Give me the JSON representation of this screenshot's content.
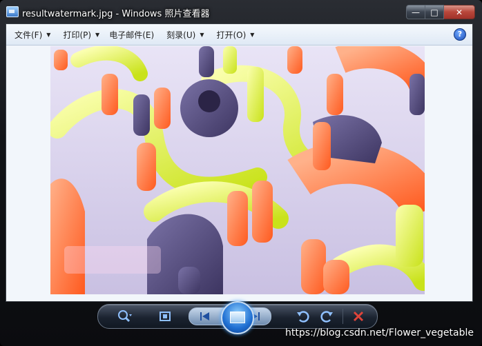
{
  "window": {
    "title": "resultwatermark.jpg - Windows 照片查看器",
    "minimize_glyph": "—",
    "maximize_glyph": "□",
    "close_glyph": "✕"
  },
  "menu": {
    "items": [
      {
        "label": "文件(F)",
        "has_arrow": true
      },
      {
        "label": "打印(P)",
        "has_arrow": true
      },
      {
        "label": "电子邮件(E)",
        "has_arrow": false
      },
      {
        "label": "刻录(U)",
        "has_arrow": true
      },
      {
        "label": "打开(O)",
        "has_arrow": true
      }
    ],
    "arrow_glyph": "▼",
    "help_glyph": "?"
  },
  "photo": {
    "description_icon": "image-abstract-3d-shapes",
    "accent_colors": [
      "#ff7a3d",
      "#e2f03a",
      "#4d4373",
      "#f7f29a"
    ]
  },
  "toolbar": {
    "icons": [
      "zoom-icon",
      "actual-size-icon",
      "previous-icon",
      "slideshow-icon",
      "next-icon",
      "rotate-ccw-icon",
      "rotate-cw-icon",
      "delete-icon"
    ]
  },
  "overlay": {
    "watermark_text": "https://blog.csdn.net/Flower_vegetable"
  }
}
